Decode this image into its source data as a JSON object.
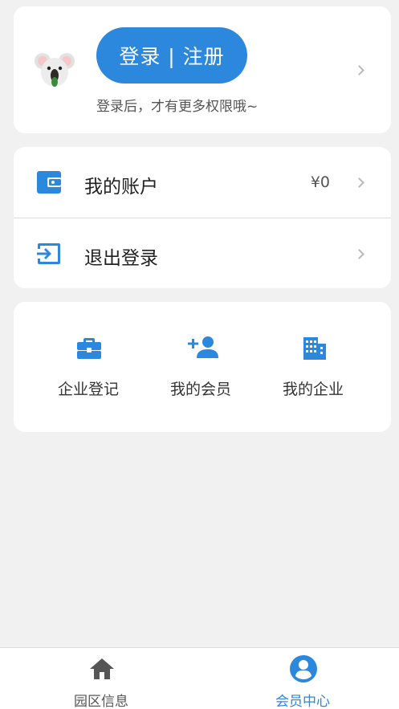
{
  "profile": {
    "login_button_label": "登录 | 注册",
    "login_hint": "登录后，才有更多权限哦~",
    "avatar_icon": "koala-avatar"
  },
  "menu": {
    "items": [
      {
        "label": "我的账户",
        "value": "¥0",
        "icon": "wallet-icon"
      },
      {
        "label": "退出登录",
        "value": "",
        "icon": "logout-icon"
      }
    ]
  },
  "grid": {
    "items": [
      {
        "label": "企业登记",
        "icon": "briefcase-icon"
      },
      {
        "label": "我的会员",
        "icon": "add-person-icon"
      },
      {
        "label": "我的企业",
        "icon": "building-icon"
      }
    ]
  },
  "tabbar": {
    "tabs": [
      {
        "label": "园区信息",
        "icon": "home-icon",
        "active": false
      },
      {
        "label": "会员中心",
        "icon": "account-circle-icon",
        "active": true
      }
    ]
  },
  "colors": {
    "accent": "#2c88dc",
    "background": "#f1f1f1",
    "card": "#ffffff",
    "inactive_icon": "#555555"
  }
}
